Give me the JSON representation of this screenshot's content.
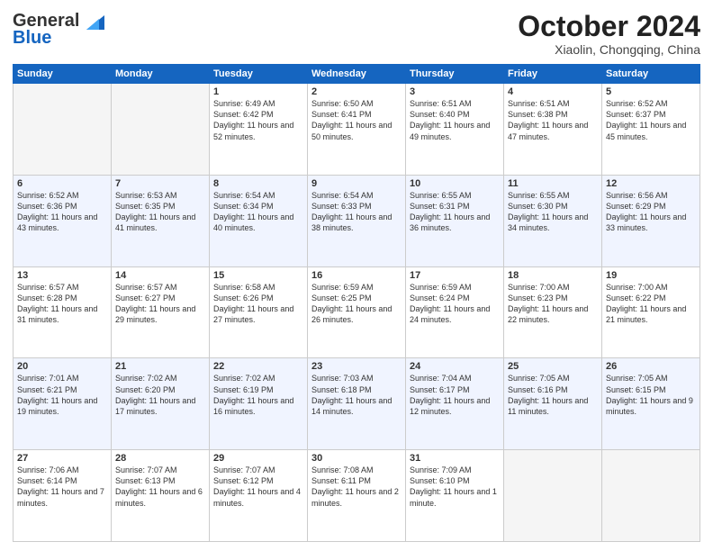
{
  "logo": {
    "line1": "General",
    "line2": "Blue"
  },
  "title": "October 2024",
  "subtitle": "Xiaolin, Chongqing, China",
  "headers": [
    "Sunday",
    "Monday",
    "Tuesday",
    "Wednesday",
    "Thursday",
    "Friday",
    "Saturday"
  ],
  "weeks": [
    [
      {
        "day": "",
        "info": ""
      },
      {
        "day": "",
        "info": ""
      },
      {
        "day": "1",
        "sunrise": "6:49 AM",
        "sunset": "6:42 PM",
        "daylight": "11 hours and 52 minutes."
      },
      {
        "day": "2",
        "sunrise": "6:50 AM",
        "sunset": "6:41 PM",
        "daylight": "11 hours and 50 minutes."
      },
      {
        "day": "3",
        "sunrise": "6:51 AM",
        "sunset": "6:40 PM",
        "daylight": "11 hours and 49 minutes."
      },
      {
        "day": "4",
        "sunrise": "6:51 AM",
        "sunset": "6:38 PM",
        "daylight": "11 hours and 47 minutes."
      },
      {
        "day": "5",
        "sunrise": "6:52 AM",
        "sunset": "6:37 PM",
        "daylight": "11 hours and 45 minutes."
      }
    ],
    [
      {
        "day": "6",
        "sunrise": "6:52 AM",
        "sunset": "6:36 PM",
        "daylight": "11 hours and 43 minutes."
      },
      {
        "day": "7",
        "sunrise": "6:53 AM",
        "sunset": "6:35 PM",
        "daylight": "11 hours and 41 minutes."
      },
      {
        "day": "8",
        "sunrise": "6:54 AM",
        "sunset": "6:34 PM",
        "daylight": "11 hours and 40 minutes."
      },
      {
        "day": "9",
        "sunrise": "6:54 AM",
        "sunset": "6:33 PM",
        "daylight": "11 hours and 38 minutes."
      },
      {
        "day": "10",
        "sunrise": "6:55 AM",
        "sunset": "6:31 PM",
        "daylight": "11 hours and 36 minutes."
      },
      {
        "day": "11",
        "sunrise": "6:55 AM",
        "sunset": "6:30 PM",
        "daylight": "11 hours and 34 minutes."
      },
      {
        "day": "12",
        "sunrise": "6:56 AM",
        "sunset": "6:29 PM",
        "daylight": "11 hours and 33 minutes."
      }
    ],
    [
      {
        "day": "13",
        "sunrise": "6:57 AM",
        "sunset": "6:28 PM",
        "daylight": "11 hours and 31 minutes."
      },
      {
        "day": "14",
        "sunrise": "6:57 AM",
        "sunset": "6:27 PM",
        "daylight": "11 hours and 29 minutes."
      },
      {
        "day": "15",
        "sunrise": "6:58 AM",
        "sunset": "6:26 PM",
        "daylight": "11 hours and 27 minutes."
      },
      {
        "day": "16",
        "sunrise": "6:59 AM",
        "sunset": "6:25 PM",
        "daylight": "11 hours and 26 minutes."
      },
      {
        "day": "17",
        "sunrise": "6:59 AM",
        "sunset": "6:24 PM",
        "daylight": "11 hours and 24 minutes."
      },
      {
        "day": "18",
        "sunrise": "7:00 AM",
        "sunset": "6:23 PM",
        "daylight": "11 hours and 22 minutes."
      },
      {
        "day": "19",
        "sunrise": "7:00 AM",
        "sunset": "6:22 PM",
        "daylight": "11 hours and 21 minutes."
      }
    ],
    [
      {
        "day": "20",
        "sunrise": "7:01 AM",
        "sunset": "6:21 PM",
        "daylight": "11 hours and 19 minutes."
      },
      {
        "day": "21",
        "sunrise": "7:02 AM",
        "sunset": "6:20 PM",
        "daylight": "11 hours and 17 minutes."
      },
      {
        "day": "22",
        "sunrise": "7:02 AM",
        "sunset": "6:19 PM",
        "daylight": "11 hours and 16 minutes."
      },
      {
        "day": "23",
        "sunrise": "7:03 AM",
        "sunset": "6:18 PM",
        "daylight": "11 hours and 14 minutes."
      },
      {
        "day": "24",
        "sunrise": "7:04 AM",
        "sunset": "6:17 PM",
        "daylight": "11 hours and 12 minutes."
      },
      {
        "day": "25",
        "sunrise": "7:05 AM",
        "sunset": "6:16 PM",
        "daylight": "11 hours and 11 minutes."
      },
      {
        "day": "26",
        "sunrise": "7:05 AM",
        "sunset": "6:15 PM",
        "daylight": "11 hours and 9 minutes."
      }
    ],
    [
      {
        "day": "27",
        "sunrise": "7:06 AM",
        "sunset": "6:14 PM",
        "daylight": "11 hours and 7 minutes."
      },
      {
        "day": "28",
        "sunrise": "7:07 AM",
        "sunset": "6:13 PM",
        "daylight": "11 hours and 6 minutes."
      },
      {
        "day": "29",
        "sunrise": "7:07 AM",
        "sunset": "6:12 PM",
        "daylight": "11 hours and 4 minutes."
      },
      {
        "day": "30",
        "sunrise": "7:08 AM",
        "sunset": "6:11 PM",
        "daylight": "11 hours and 2 minutes."
      },
      {
        "day": "31",
        "sunrise": "7:09 AM",
        "sunset": "6:10 PM",
        "daylight": "11 hours and 1 minute."
      },
      {
        "day": "",
        "info": ""
      },
      {
        "day": "",
        "info": ""
      }
    ]
  ]
}
